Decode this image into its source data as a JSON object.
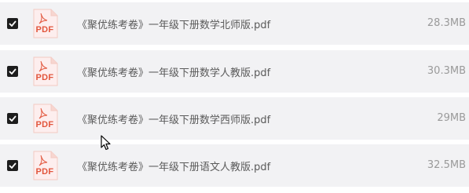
{
  "files": [
    {
      "name": "《聚优练考卷》一年级下册数学北师版.pdf",
      "size": "28.3MB",
      "checked": true,
      "icon": "pdf-icon",
      "icon_label": "PDF"
    },
    {
      "name": "《聚优练考卷》一年级下册数学人教版.pdf",
      "size": "30.3MB",
      "checked": true,
      "icon": "pdf-icon",
      "icon_label": "PDF"
    },
    {
      "name": "《聚优练考卷》一年级下册数学西师版.pdf",
      "size": "29MB",
      "checked": true,
      "icon": "pdf-icon",
      "icon_label": "PDF"
    },
    {
      "name": "《聚优练考卷》一年级下册语文人教版.pdf",
      "size": "32.5MB",
      "checked": true,
      "icon": "pdf-icon",
      "icon_label": "PDF"
    }
  ],
  "colors": {
    "row_background": "#f2f2f4",
    "checkbox": "#1d1d1d",
    "pdf_accent": "#e2563d",
    "name_text": "#5a5a5a",
    "size_text": "#9a9a9a"
  },
  "cursor": "arrow-cursor-icon"
}
